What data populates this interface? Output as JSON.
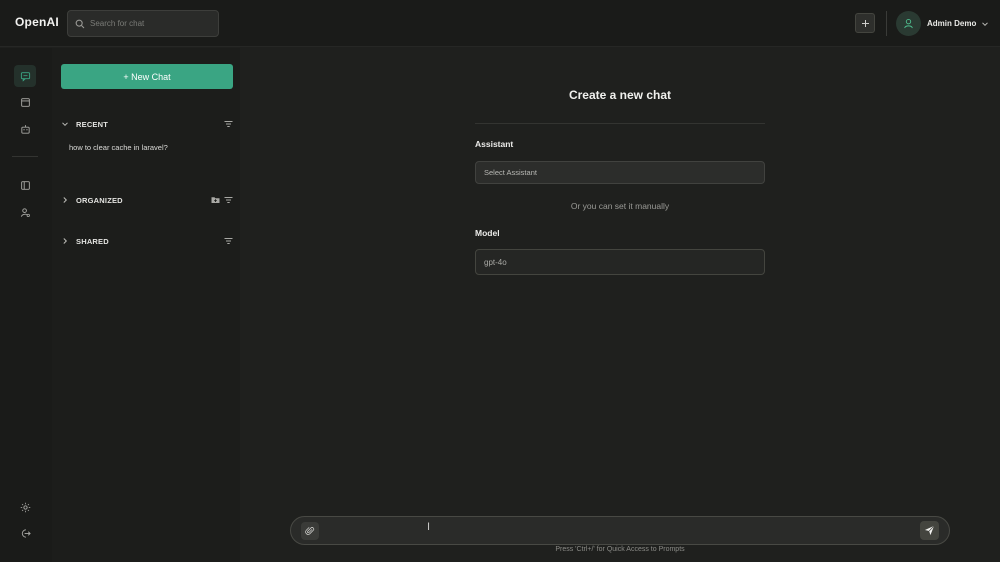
{
  "app": {
    "brand": "OpenAI",
    "search_placeholder": "Search for chat",
    "user_name": "Admin Demo"
  },
  "rail": {
    "items": [
      {
        "icon": "chat-icon",
        "active": true
      },
      {
        "icon": "document-icon",
        "active": false
      },
      {
        "icon": "robot-icon",
        "active": false
      },
      {
        "icon": "sidebar-panel-icon",
        "active": false
      },
      {
        "icon": "user-settings-icon",
        "active": false
      }
    ],
    "bottom": [
      {
        "icon": "theme-sun-icon"
      },
      {
        "icon": "logout-icon"
      }
    ]
  },
  "sidebar": {
    "new_chat_label": "+ New Chat",
    "sections": [
      {
        "title": "RECENT",
        "expanded": true,
        "items": [
          "how to clear cache in laravel?"
        ]
      },
      {
        "title": "ORGANIZED",
        "expanded": false
      },
      {
        "title": "SHARED",
        "expanded": false
      }
    ]
  },
  "main": {
    "title": "Create a new chat",
    "assistant_label": "Assistant",
    "assistant_placeholder": "Select Assistant",
    "or_text": "Or you can set it manually",
    "model_label": "Model",
    "model_value": "gpt-4o"
  },
  "composer": {
    "value": "",
    "hint": "Press 'Ctrl+/' for Quick Access to Prompts"
  },
  "colors": {
    "accent": "#3aa583",
    "background": "#1f201e",
    "sidebar": "#1c1d1b"
  }
}
